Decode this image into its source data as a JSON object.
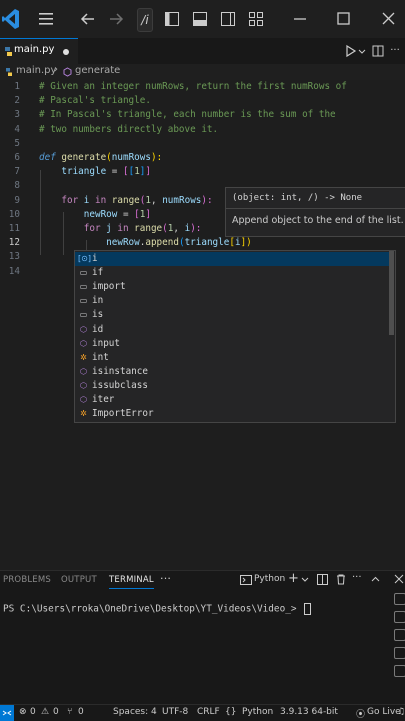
{
  "titlebar": {
    "command_center_text": "/i"
  },
  "tab": {
    "filename": "main.py"
  },
  "breadcrumb": {
    "file": "main.py",
    "symbol": "generate"
  },
  "editor": {
    "line_numbers": [
      "1",
      "2",
      "3",
      "4",
      "5",
      "6",
      "7",
      "8",
      "9",
      "10",
      "11",
      "12",
      "13",
      "14"
    ],
    "current_line": "12",
    "lines": [
      [
        {
          "t": "# Given an integer numRows, return the first numRows of",
          "c": "c"
        }
      ],
      [
        {
          "t": "# Pascal's triangle.",
          "c": "c"
        }
      ],
      [
        {
          "t": "# In Pascal's triangle, each number is the sum of the",
          "c": "c"
        }
      ],
      [
        {
          "t": "# two numbers directly above it.",
          "c": "c"
        }
      ],
      [],
      [
        {
          "t": "def ",
          "c": "k"
        },
        {
          "t": "generate",
          "c": "f"
        },
        {
          "t": "(",
          "c": "y"
        },
        {
          "t": "numRows",
          "c": "p"
        },
        {
          "t": "):",
          "c": "y"
        }
      ],
      [
        {
          "t": "    triangle",
          "c": "v"
        },
        {
          "t": " = ",
          "c": "o"
        },
        {
          "t": "[",
          "c": "pk"
        },
        {
          "t": "[",
          "c": "bl"
        },
        {
          "t": "1",
          "c": "n"
        },
        {
          "t": "]",
          "c": "bl"
        },
        {
          "t": "]",
          "c": "pk"
        }
      ],
      [],
      [
        {
          "t": "    for ",
          "c": "kw"
        },
        {
          "t": "i",
          "c": "v"
        },
        {
          "t": " in ",
          "c": "kw"
        },
        {
          "t": "range",
          "c": "f"
        },
        {
          "t": "(",
          "c": "pk"
        },
        {
          "t": "1",
          "c": "n"
        },
        {
          "t": ", ",
          "c": "o"
        },
        {
          "t": "numRows",
          "c": "p"
        },
        {
          "t": "):",
          "c": "pk"
        }
      ],
      [
        {
          "t": "        newRow",
          "c": "v"
        },
        {
          "t": " = ",
          "c": "o"
        },
        {
          "t": "[",
          "c": "pk"
        },
        {
          "t": "1",
          "c": "n"
        },
        {
          "t": "]",
          "c": "pk"
        }
      ],
      [
        {
          "t": "        for ",
          "c": "kw"
        },
        {
          "t": "j",
          "c": "v"
        },
        {
          "t": " in ",
          "c": "kw"
        },
        {
          "t": "range",
          "c": "f"
        },
        {
          "t": "(",
          "c": "pk"
        },
        {
          "t": "1",
          "c": "n"
        },
        {
          "t": ", ",
          "c": "o"
        },
        {
          "t": "i",
          "c": "v"
        },
        {
          "t": "):",
          "c": "pk"
        }
      ],
      [
        {
          "t": "            newRow",
          "c": "v"
        },
        {
          "t": ".",
          "c": "o"
        },
        {
          "t": "append",
          "c": "f"
        },
        {
          "t": "(",
          "c": "bl"
        },
        {
          "t": "triangle",
          "c": "v"
        },
        {
          "t": "[",
          "c": "y"
        },
        {
          "t": "i",
          "c": "v"
        },
        {
          "t": "])",
          "c": "y"
        }
      ],
      [],
      []
    ]
  },
  "hover": {
    "signature": "(object: int, /) -> None",
    "doc": "Append object to the end of the list."
  },
  "suggestions": [
    {
      "label": "i",
      "kind": "variable",
      "icon": "variable-icon"
    },
    {
      "label": "if",
      "kind": "keyword",
      "icon": "keyword-icon"
    },
    {
      "label": "import",
      "kind": "keyword",
      "icon": "keyword-icon"
    },
    {
      "label": "in",
      "kind": "keyword",
      "icon": "keyword-icon"
    },
    {
      "label": "is",
      "kind": "keyword",
      "icon": "keyword-icon"
    },
    {
      "label": "id",
      "kind": "function",
      "icon": "method-icon"
    },
    {
      "label": "input",
      "kind": "function",
      "icon": "method-icon"
    },
    {
      "label": "int",
      "kind": "class",
      "icon": "class-icon"
    },
    {
      "label": "isinstance",
      "kind": "function",
      "icon": "method-icon"
    },
    {
      "label": "issubclass",
      "kind": "function",
      "icon": "method-icon"
    },
    {
      "label": "iter",
      "kind": "function",
      "icon": "method-icon"
    },
    {
      "label": "ImportError",
      "kind": "class",
      "icon": "class-icon"
    }
  ],
  "panel": {
    "tabs": [
      "PROBLEMS",
      "OUTPUT",
      "TERMINAL"
    ],
    "active_tab": "TERMINAL",
    "more": "···",
    "shell": "Python",
    "prompt": "PS C:\\Users\\rroka\\OneDrive\\Desktop\\YT_Videos\\Video_> "
  },
  "statusbar": {
    "errors": "0",
    "warnings": "0",
    "ports": "0",
    "spaces": "Spaces: 4",
    "encoding": "UTF-8",
    "eol": "CRLF",
    "language": "Python",
    "interpreter": "3.9.13 64-bit",
    "golive": "Go Live"
  },
  "colors": {
    "accent": "#0078d4",
    "editor_bg": "#1e1e1e",
    "selection": "#04395e"
  }
}
